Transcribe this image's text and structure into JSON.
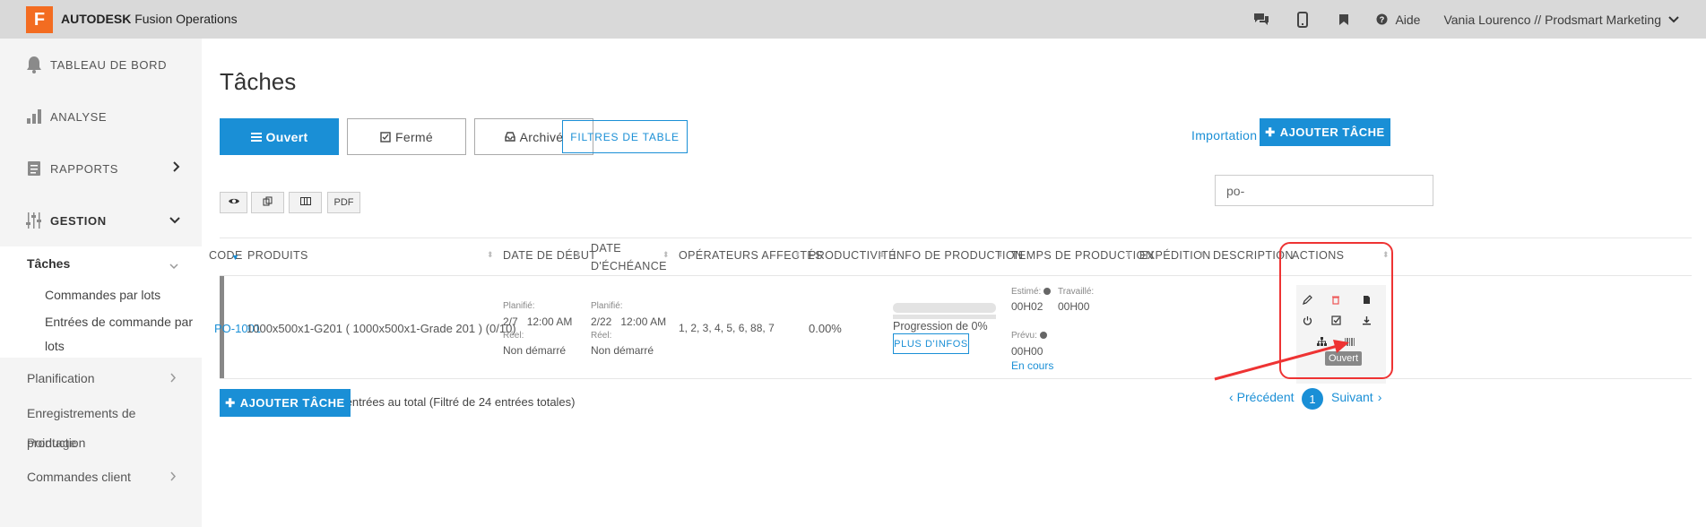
{
  "topbar": {
    "logo_letter": "F",
    "brand_bold": "AUTODESK",
    "brand_rest": "Fusion Operations",
    "help_label": "Aide",
    "user_label": "Vania Lourenco // Prodsmart Marketing"
  },
  "sidebar": {
    "dashboard": "TABLEAU DE BORD",
    "analysis": "ANALYSE",
    "reports": "RAPPORTS",
    "management": "GESTION",
    "tasks": "Tâches",
    "batch_orders": "Commandes par lots",
    "order_entries_1": "Entrées de commande par",
    "order_entries_2": "lots",
    "planning": "Planification",
    "production_records_1": "Enregistrements de",
    "production_records_2": "production",
    "production_overlap": "Pointage",
    "customer_orders": "Commandes client"
  },
  "page": {
    "title": "Tâches",
    "tabs": [
      "Ouvert",
      "Fermé",
      "Archivé"
    ],
    "filters_button": "FILTRES DE TABLE",
    "import_link": "Importation",
    "add_task_top": "AJOUTER TÂCHE",
    "add_task_bottom": "AJOUTER TÂCHE",
    "pdf_label": "PDF",
    "search_value": "po-"
  },
  "table": {
    "headers": {
      "code": "CODE",
      "products": "PRODUITS",
      "start_date": "DATE DE DÉBUT",
      "due_date_1": "DATE",
      "due_date_2": "D'ÉCHÉANCE",
      "operators": "OPÉRATEURS AFFECTÉS",
      "productivity": "PRODUCTIVITÉ",
      "production_info": "INFO DE PRODUCTION",
      "production_time": "TEMPS DE PRODUCTION",
      "shipping": "EXPÉDITION",
      "description": "DESCRIPTION",
      "actions": "ACTIONS"
    },
    "row": {
      "code": "PO-1001",
      "product": "1000x500x1-G201 ( 1000x500x1-Grade 201 ) (0/10)",
      "start_planned_label": "Planifié:",
      "start_planned_date": "2/7",
      "start_planned_time": "12:00 AM",
      "start_real_label": "Réel:",
      "start_real_value": "Non démarré",
      "due_planned_label": "Planifié:",
      "due_planned_date": "2/22",
      "due_planned_time": "12:00 AM",
      "due_real_label": "Réel:",
      "due_real_value": "Non démarré",
      "operators": "1, 2, 3, 4, 5, 6, 88, 7",
      "productivity": "0.00%",
      "progress_fraction": 0,
      "progress_label": "Progression de 0%",
      "more_info": "PLUS D'INFOS",
      "estimated_label": "Estimé:",
      "estimated_value": "00H02",
      "worked_label": "Travaillé:",
      "worked_value": "00H00",
      "planned_label": "Prévu:",
      "planned_value": "00H00",
      "status": "En cours",
      "tooltip": "Ouvert"
    }
  },
  "footer": {
    "info": "Affichage de 1 à 1 sur 1 entrées au total (Filtré de 24 entrées totales)",
    "prev": "Précédent",
    "page": "1",
    "next": "Suivant"
  },
  "colors": {
    "accent": "#1a8fd6",
    "brand_orange": "#f36c21",
    "highlight_red": "#e33333"
  }
}
